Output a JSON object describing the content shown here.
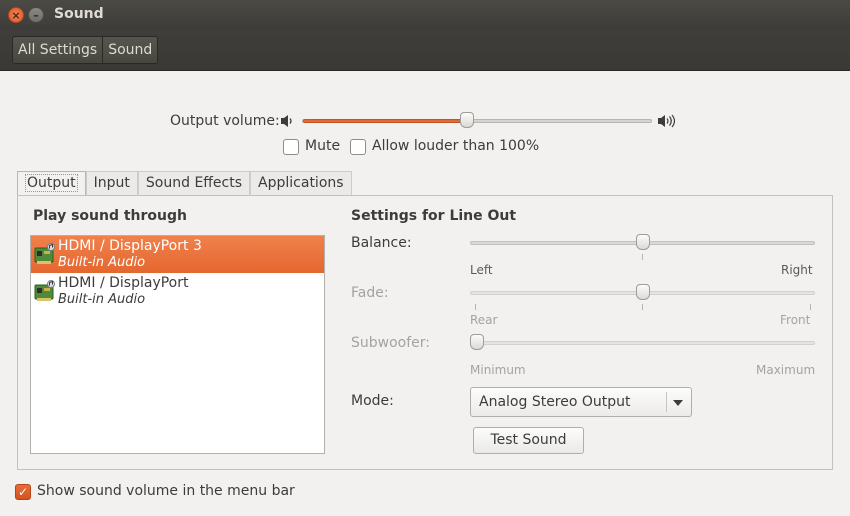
{
  "window": {
    "title": "Sound"
  },
  "breadcrumb": [
    "All Settings",
    "Sound"
  ],
  "output_volume": {
    "label": "Output volume:",
    "level": 0.47
  },
  "mute_label": "Mute",
  "mute_checked": false,
  "allow_louder_label": "Allow louder than 100%",
  "allow_louder_checked": false,
  "tabs": [
    {
      "label": "Output",
      "active": true
    },
    {
      "label": "Input",
      "active": false
    },
    {
      "label": "Sound Effects",
      "active": false
    },
    {
      "label": "Applications",
      "active": false
    }
  ],
  "play_through": {
    "heading": "Play sound through",
    "devices": [
      {
        "name": "HDMI / DisplayPort 3",
        "sub": "Built-in Audio",
        "selected": true
      },
      {
        "name": "HDMI / DisplayPort",
        "sub": "Built-in Audio",
        "selected": false
      }
    ]
  },
  "settings": {
    "heading": "Settings for Line Out",
    "balance": {
      "label": "Balance:",
      "left": "Left",
      "right": "Right",
      "value": 0.5
    },
    "fade": {
      "label": "Fade:",
      "left": "Rear",
      "right": "Front",
      "value": 0.5
    },
    "subwoofer": {
      "label": "Subwoofer:",
      "left": "Minimum",
      "right": "Maximum",
      "value": 0.0
    },
    "mode_label": "Mode:",
    "mode_value": "Analog Stereo Output",
    "test_button": "Test Sound"
  },
  "menu_bar_label": "Show sound volume in the menu bar",
  "menu_bar_checked": true,
  "colors": {
    "accent": "#e46a33",
    "titlebar": "#3c3b37"
  },
  "icons": [
    "close-icon",
    "minimize-icon",
    "speaker-low-icon",
    "speaker-high-icon",
    "audio-card-icon",
    "chevron-down-icon",
    "checkmark-icon"
  ]
}
